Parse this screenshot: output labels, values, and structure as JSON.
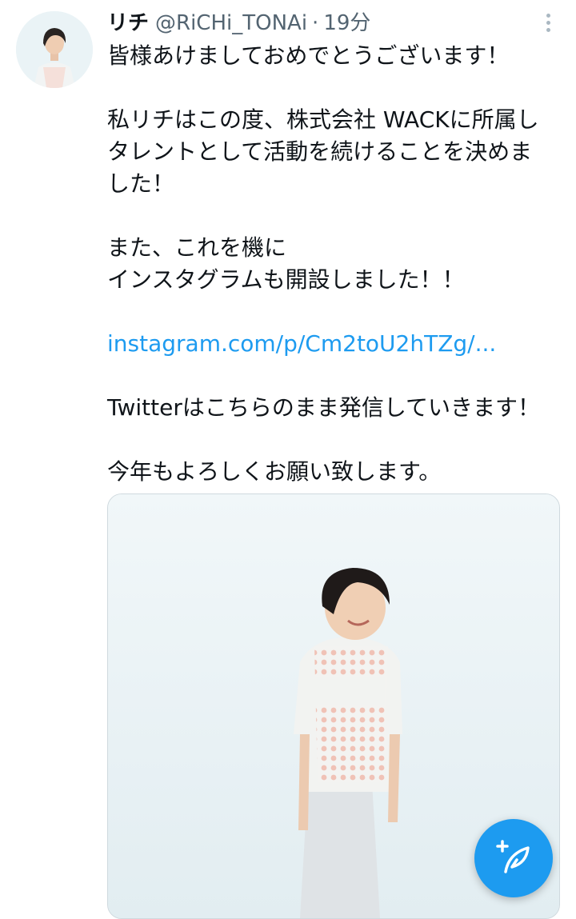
{
  "tweet": {
    "author": {
      "name": "リチ",
      "handle": "@RiCHi_TONAi",
      "separator": "·",
      "time": "19分"
    },
    "paragraphs": [
      {
        "lines": [
          "皆様あけましておめでとうございます！"
        ]
      },
      {
        "lines": [
          "私リチはこの度、株式会社 WACKに所属し",
          "タレントとして活動を続けることを決めま",
          "した！"
        ]
      },
      {
        "lines": [
          "また、これを機に",
          "インスタグラムも開設しました！！"
        ]
      },
      {
        "link": "instagram.com/p/Cm2toU2hTZg/..."
      },
      {
        "lines": [
          "Twitterはこちらのまま発信していきます！"
        ]
      },
      {
        "lines": [
          "今年もよろしくお願い致します。"
        ]
      }
    ]
  },
  "icons": {
    "more": "more-vertical-icon",
    "compose": "compose-tweet-icon"
  },
  "colors": {
    "accent": "#1d9bf0",
    "secondary_text": "#536471"
  }
}
